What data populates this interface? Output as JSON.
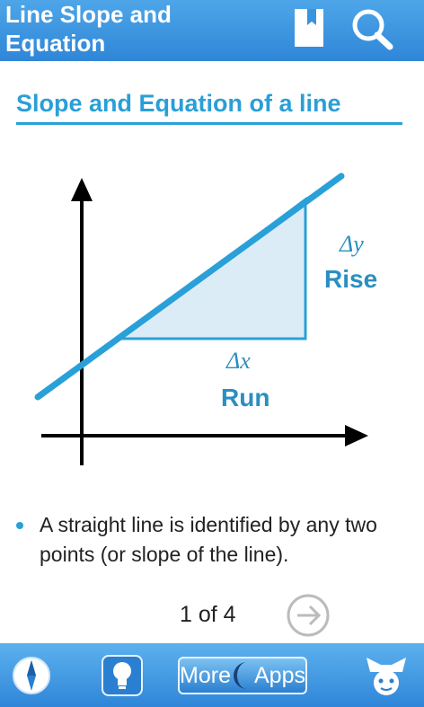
{
  "header": {
    "title_line1": "Line Slope and",
    "title_line2": "Equation",
    "bookmark_icon": "bookmark-icon",
    "search_icon": "search-icon"
  },
  "content": {
    "section_title": "Slope and Equation of a line",
    "diagram": {
      "delta_y": "Δy",
      "rise": "Rise",
      "delta_x": "Δx",
      "run": "Run"
    },
    "bullet": "A straight line is identified by any two points (or slope of the line)."
  },
  "pager": {
    "text": "1 of 4",
    "next_icon": "arrow-right-circle-icon"
  },
  "footer": {
    "compass_icon": "compass-icon",
    "lightbulb_icon": "lightbulb-icon",
    "more_label": "More",
    "apps_label": "Apps",
    "mascot_icon": "mascot-icon"
  },
  "colors": {
    "accent": "#2aa0d8",
    "header_bg": "#3a93dd",
    "triangle_fill": "#dcecf7"
  }
}
